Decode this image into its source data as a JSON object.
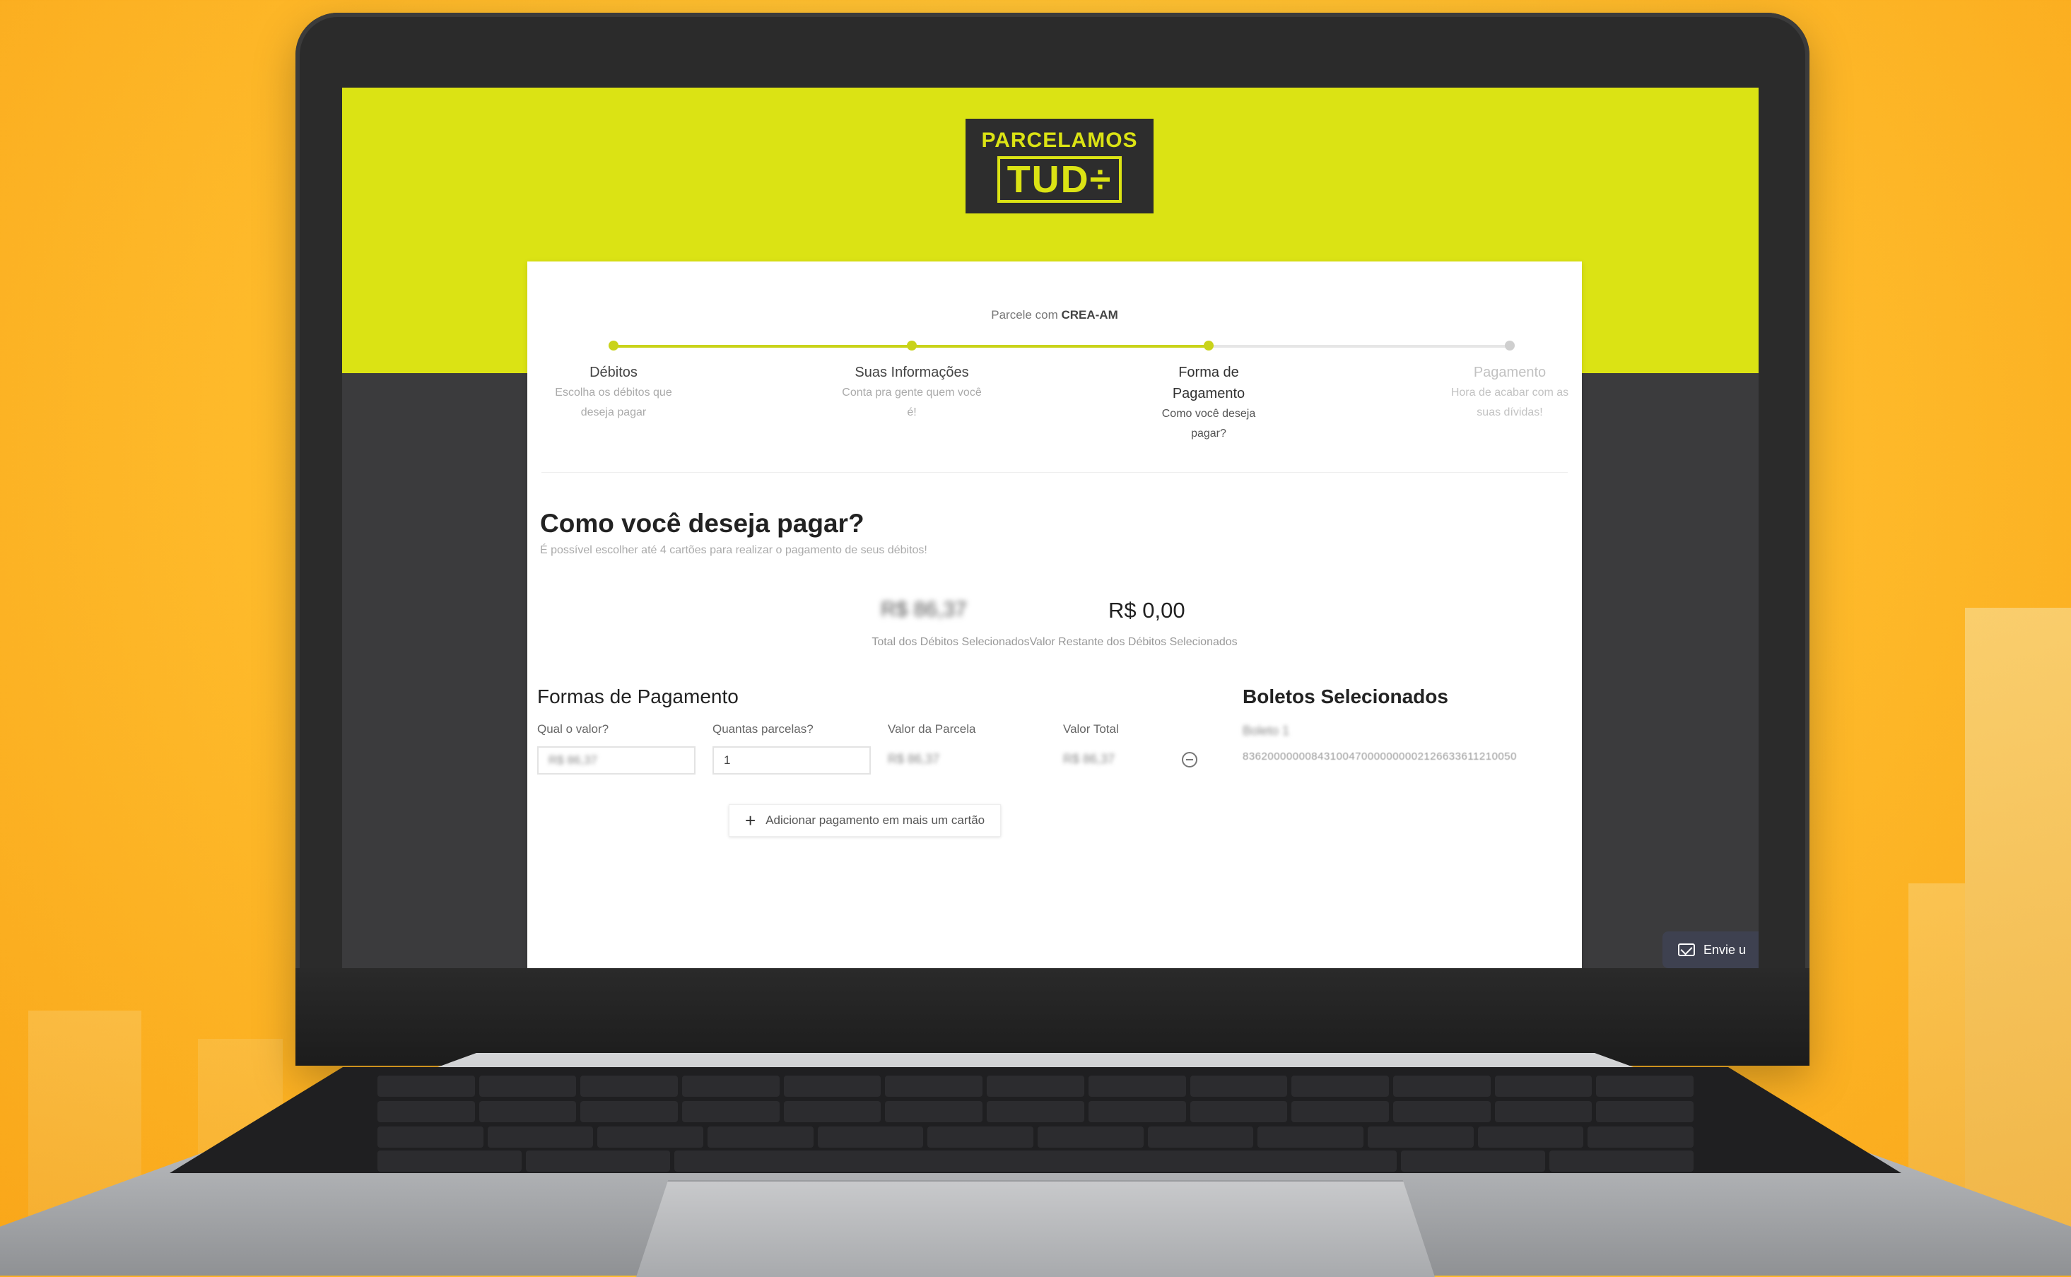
{
  "brand": {
    "logo_top": "PARCELAMOS",
    "logo_bottom": "TUD÷",
    "colors": {
      "accent": "#dbe314",
      "dark": "#2d2d2d",
      "background": "#ffbe2e"
    }
  },
  "partner": {
    "prefix": "Parcele com",
    "name": "CREA-AM"
  },
  "steps": [
    {
      "title": "Débitos",
      "description": "Escolha os débitos que deseja pagar",
      "status": "done"
    },
    {
      "title": "Suas Informações",
      "description": "Conta pra gente quem você é!",
      "status": "done"
    },
    {
      "title": "Forma de Pagamento",
      "description": "Como você deseja pagar?",
      "status": "current"
    },
    {
      "title": "Pagamento",
      "description": "Hora de acabar com as suas dívidas!",
      "status": "todo"
    }
  ],
  "page": {
    "title": "Como você deseja pagar?",
    "subtitle": "É possível escolher até 4 cartões para realizar o pagamento de seus débitos!"
  },
  "totals": {
    "selected_total": "R$ 86,37",
    "remaining_value": "R$ 0,00",
    "label": "Total dos Débitos SelecionadosValor Restante dos Débitos Selecionados"
  },
  "payment": {
    "title": "Formas de Pagamento",
    "columns": [
      "Qual o valor?",
      "Quantas parcelas?",
      "Valor da Parcela",
      "Valor Total"
    ],
    "row": {
      "amount": "R$ 86,37",
      "installments": "1",
      "installment_value": "R$ 86,37",
      "total_value": "R$ 86,37"
    },
    "add_card_label": "Adicionar pagamento em mais um cartão",
    "add_icon": "plus-icon",
    "remove_icon": "remove-circle-icon"
  },
  "boletos": {
    "title": "Boletos Selecionados",
    "item_name": "Boleto 1",
    "item_code": "83620000000843100470000000002126633611210050"
  },
  "feedback": {
    "label": "Envie u",
    "icon": "mail-icon"
  }
}
